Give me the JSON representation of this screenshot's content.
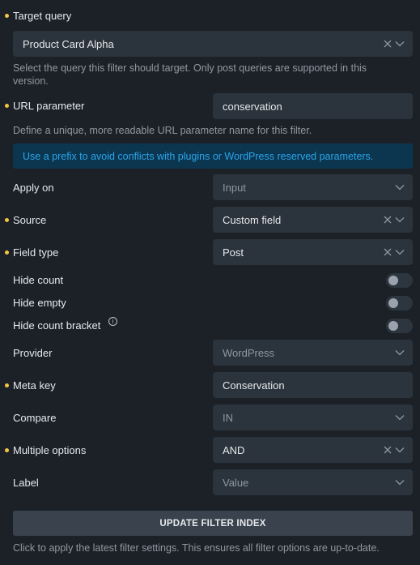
{
  "fields": {
    "target_query": {
      "label": "Target query",
      "value": "Product Card Alpha",
      "help": "Select the query this filter should target. Only post queries are supported in this version."
    },
    "url_parameter": {
      "label": "URL parameter",
      "value": "conservation",
      "help": "Define a unique, more readable URL parameter name for this filter.",
      "notice": "Use a prefix to avoid conflicts with plugins or WordPress reserved parameters."
    },
    "apply_on": {
      "label": "Apply on",
      "placeholder": "Input"
    },
    "source": {
      "label": "Source",
      "value": "Custom field"
    },
    "field_type": {
      "label": "Field type",
      "value": "Post"
    },
    "hide_count": {
      "label": "Hide count",
      "enabled": false
    },
    "hide_empty": {
      "label": "Hide empty",
      "enabled": false
    },
    "hide_count_bracket": {
      "label": "Hide count bracket",
      "info_glyph": "i",
      "enabled": false
    },
    "provider": {
      "label": "Provider",
      "placeholder": "WordPress"
    },
    "meta_key": {
      "label": "Meta key",
      "value": "Conservation"
    },
    "compare": {
      "label": "Compare",
      "placeholder": "IN"
    },
    "multiple_options": {
      "label": "Multiple options",
      "value": "AND"
    },
    "label": {
      "label": "Label",
      "placeholder": "Value"
    }
  },
  "update_button": {
    "label": "UPDATE FILTER INDEX",
    "help": "Click to apply the latest filter settings. This ensures all filter options are up-to-date."
  },
  "colors": {
    "background": "#1c2127",
    "control": "#2b333c",
    "required_dot": "#f5c542",
    "notice_bg": "#0c3550",
    "notice_text": "#2ba5e8"
  }
}
